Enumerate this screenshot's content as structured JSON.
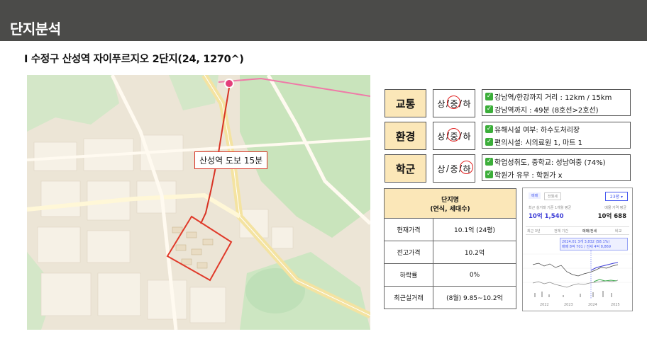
{
  "header": {
    "title": "단지분석"
  },
  "subtitle": "I 수정구 산성역 자이푸르지오 2단지(24, 1270^)",
  "map": {
    "walk_label": "산성역 도보 15분"
  },
  "ratings": [
    {
      "label": "교통",
      "grades": [
        "상",
        "중",
        "하"
      ],
      "selected": 1,
      "lines": [
        "강남역/한강까지 거리 : 12km / 15km",
        "강남역까지 : 49분 (8호선>2호선)"
      ]
    },
    {
      "label": "환경",
      "grades": [
        "상",
        "중",
        "하"
      ],
      "selected": 1,
      "lines": [
        "유해시설 여부: 하수도처리장",
        "편의시설: 시의료원 1, 마트 1"
      ]
    },
    {
      "label": "학군",
      "grades": [
        "상",
        "중",
        "하"
      ],
      "selected": 2,
      "lines": [
        "학업성취도, 중학교: 성남여중 (74%)",
        "학원가 유무 : 학원가 x"
      ]
    }
  ],
  "info_table": {
    "header": [
      "단지명",
      "(연식, 세대수)"
    ],
    "rows": [
      {
        "label": "현재가격",
        "value": "10.1억 (24평)"
      },
      {
        "label": "전고가격",
        "value": "10.2억"
      },
      {
        "label": "하락률",
        "value": "0%"
      },
      {
        "label": "최근실거래",
        "value": "(8월) 9.85~10.2억"
      }
    ]
  },
  "price_card": {
    "tab_active": "매매",
    "tab_other": "전월세",
    "size_select": "23평",
    "left_caption": "최근 실거래 기준 1개월 평균",
    "left_value": "10억 1,540",
    "right_caption": "매물 가격 평균",
    "right_value": "10억 688",
    "periods": [
      "최근 3년",
      "전체 기간",
      "매매/전세",
      "비교"
    ],
    "tooltip_line1": "2024.01 3개 3,832 (58.1%)",
    "tooltip_line2": "매매 8억 701 / 전세 4억 8,869",
    "years": [
      "2022",
      "2023",
      "2024",
      "2025"
    ],
    "colors": {
      "sale": "#3b3bd6",
      "rent": "#3aa84a",
      "accent": "#4a5cf0"
    }
  }
}
